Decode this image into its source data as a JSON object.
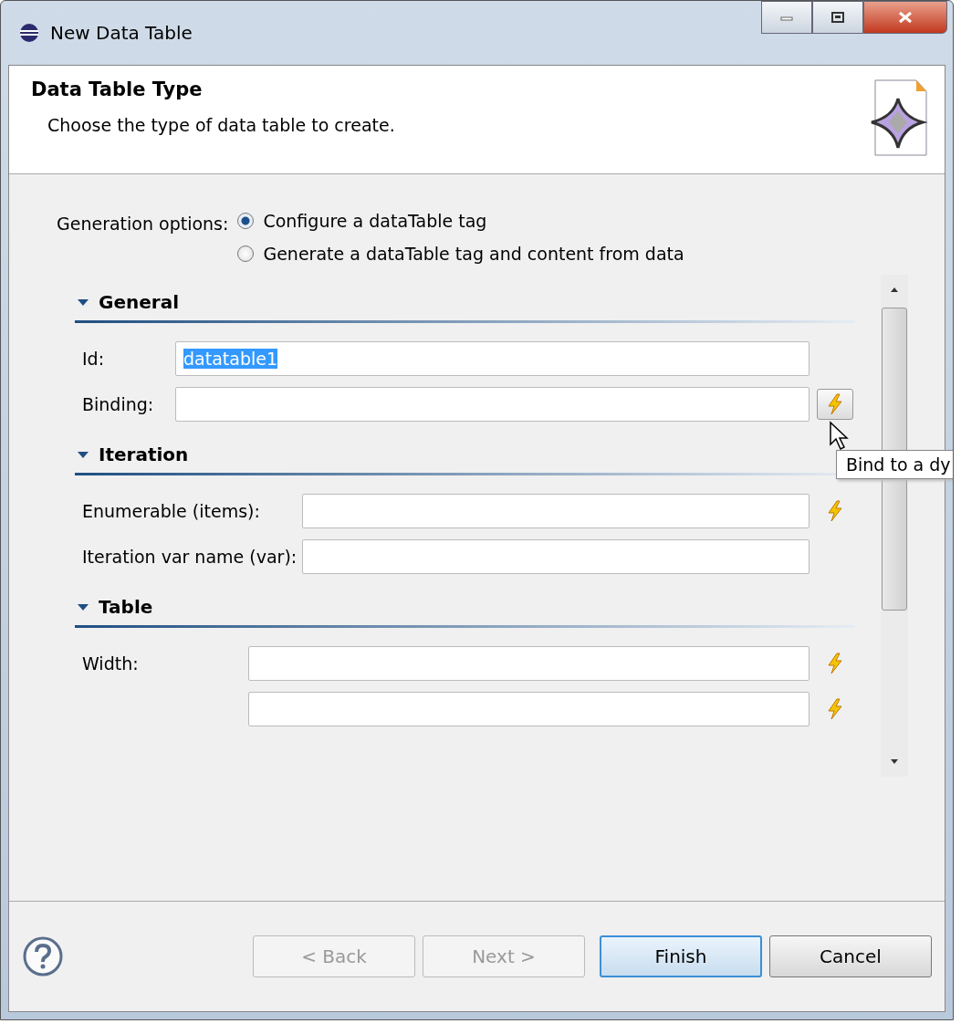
{
  "window": {
    "title": "New Data Table"
  },
  "header": {
    "title": "Data Table Type",
    "description": "Choose the type of data table to create."
  },
  "generation_options": {
    "label": "Generation options:",
    "options": [
      {
        "label": "Configure a dataTable tag",
        "selected": true
      },
      {
        "label": "Generate a dataTable tag and content from data",
        "selected": false
      }
    ]
  },
  "sections": [
    {
      "title": "General",
      "expanded": true,
      "fields": [
        {
          "kind": "plain",
          "label": "Id:",
          "value": "datatable1",
          "value_selected": true
        },
        {
          "kind": "bind_button",
          "label": "Binding:"
        }
      ]
    },
    {
      "title": "Iteration",
      "expanded": true,
      "fields": [
        {
          "kind": "bind_icon",
          "label": "Enumerable (items):"
        },
        {
          "kind": "plain",
          "label": "Iteration var name (var):"
        }
      ]
    },
    {
      "title": "Table",
      "expanded": true,
      "fields": [
        {
          "kind": "bind_icon",
          "label": "Width:"
        },
        {
          "kind": "bind_icon"
        }
      ]
    }
  ],
  "tooltip": "Bind to a dy",
  "buttons": [
    {
      "label": "< Back",
      "disabled": true,
      "default": false
    },
    {
      "label": "Next >",
      "disabled": true,
      "default": false
    },
    {
      "label": "Finish",
      "disabled": false,
      "default": true
    },
    {
      "label": "Cancel",
      "disabled": false,
      "default": false
    }
  ]
}
